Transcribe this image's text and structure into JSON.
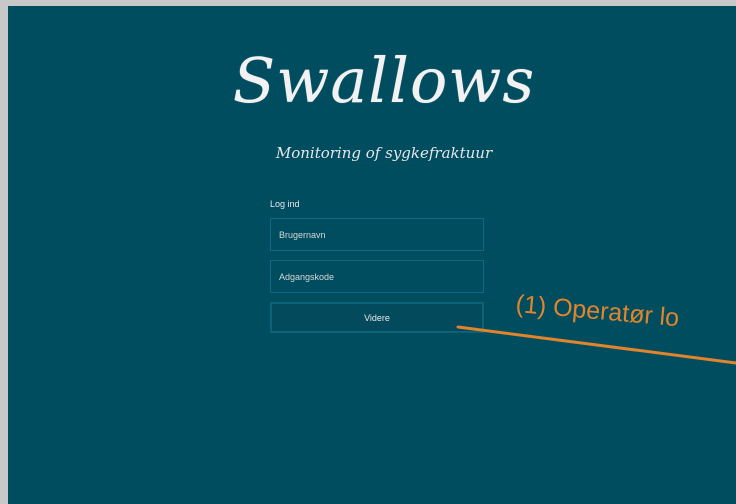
{
  "app": {
    "title": "Swallows",
    "subtitle": "Monitoring of sygkefraktuur"
  },
  "login": {
    "heading": "Log ind",
    "username_placeholder": "Brugernavn",
    "password_placeholder": "Adgangskode",
    "submit_label": "Videre"
  },
  "annotation": {
    "text": "(1) Operatør lo",
    "color": "#e1842b"
  },
  "colors": {
    "background": "#004d60",
    "border": "#0e6a80"
  }
}
